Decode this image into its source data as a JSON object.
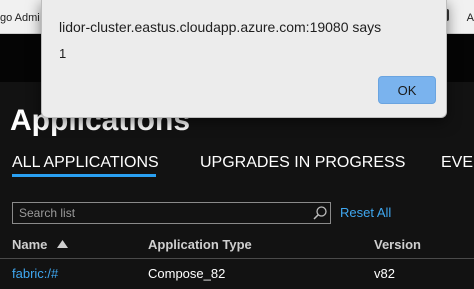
{
  "browser": {
    "tab_left_text": "go Admi",
    "tab_right_text": "A"
  },
  "dialog": {
    "origin": "lidor-cluster.eastus.cloudapp.azure.com:19080 says",
    "message": "1",
    "ok_label": "OK",
    "ok_color": "#7ab3ee"
  },
  "page": {
    "title": "Applications"
  },
  "tabs": [
    {
      "label": "ALL APPLICATIONS",
      "active": true
    },
    {
      "label": "UPGRADES IN PROGRESS",
      "active": false
    },
    {
      "label": "EVE",
      "active": false
    }
  ],
  "search": {
    "placeholder": "Search list",
    "value": ""
  },
  "reset_label": "Reset All",
  "table": {
    "columns": [
      "Name",
      "Application Type",
      "Version"
    ],
    "sort_column": "Name",
    "sort_direction": "ascending",
    "rows": [
      {
        "name": "fabric:/#",
        "type": "Compose_82",
        "version": "v82"
      }
    ]
  },
  "colors": {
    "accent": "#2aa0f2",
    "link": "#3fa7f0",
    "background": "#121212"
  },
  "icons": {
    "search": "search-icon",
    "sort": "sort-ascending-icon"
  }
}
